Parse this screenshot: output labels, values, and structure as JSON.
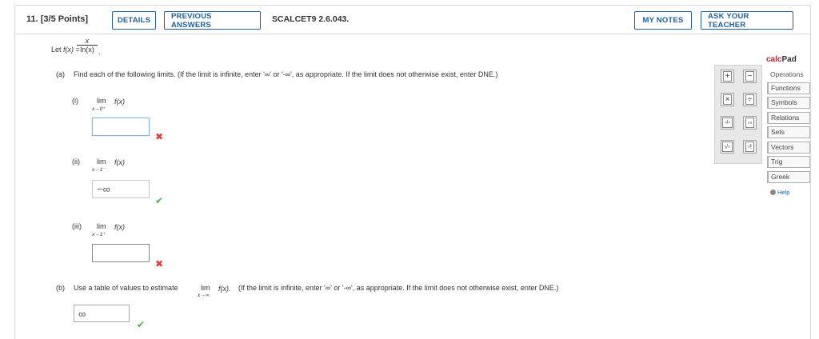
{
  "header": {
    "question_number": "11.  [3/5 Points]",
    "details_label": "DETAILS",
    "previous_answers_label": "PREVIOUS ANSWERS",
    "code": "SCALCET9 2.6.043.",
    "my_notes_label": "MY NOTES",
    "ask_teacher_label": "ASK YOUR TEACHER"
  },
  "problem": {
    "let_text": "Let ",
    "f_of_x": "f(x)",
    "equals": " = ",
    "numerator": "x",
    "denominator": "ln(x)",
    "period": "."
  },
  "part_a": {
    "label": "(a)",
    "instruction": "Find each of the following limits. (If the limit is infinite, enter '∞' or '-∞', as appropriate. If the limit does not otherwise exist, enter DNE.)",
    "items": [
      {
        "label": "(i)",
        "lim": "lim",
        "sub": "x→0⁺",
        "fx": "f(x)",
        "answer": "",
        "result": "incorrect"
      },
      {
        "label": "(ii)",
        "lim": "lim",
        "sub": "x→1⁻",
        "fx": "f(x)",
        "answer": "−∞",
        "result": "correct"
      },
      {
        "label": "(iii)",
        "lim": "lim",
        "sub": "x→1⁺",
        "fx": "f(x)",
        "answer": "",
        "result": "incorrect"
      }
    ]
  },
  "part_b": {
    "label": "(b)",
    "instruction_pre": "Use a table of values to estimate ",
    "lim": "lim",
    "sub": "x→∞",
    "fx": "f(x).",
    "instruction_post": "(If the limit is infinite, enter '∞' or '-∞', as appropriate. If the limit does not otherwise exist, enter DNE.)",
    "answer": "∞",
    "result": "correct"
  },
  "marks": {
    "incorrect": "✖",
    "correct": "✔"
  },
  "calcpad": {
    "title_accent": "calc",
    "title_rest": "Pad",
    "operations_label": "Operations",
    "buttons": [
      "+",
      "−",
      "×",
      "÷",
      "▫/▫",
      "▫▫",
      "√▫",
      "▫!"
    ],
    "tabs": [
      "Functions",
      "Symbols",
      "Relations",
      "Sets",
      "Vectors",
      "Trig",
      "Greek"
    ],
    "help_label": "Help"
  },
  "colors": {
    "link_blue": "#1f5f9e",
    "incorrect_red": "#d24040",
    "correct_green": "#4caf50",
    "calc_red": "#c0272d"
  }
}
